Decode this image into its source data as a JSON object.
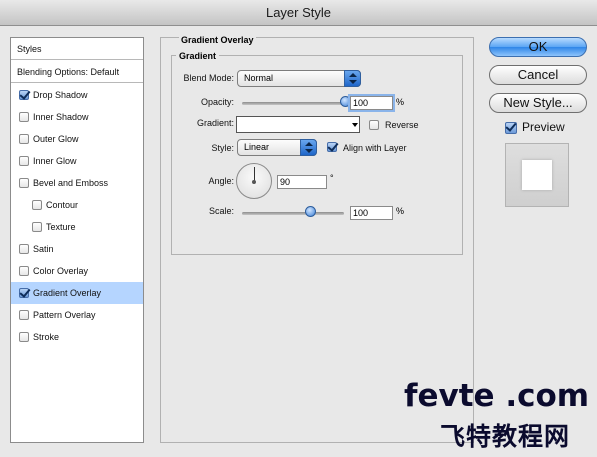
{
  "window": {
    "title": "Layer Style"
  },
  "style_list": {
    "header": "Styles",
    "blending": "Blending Options: Default",
    "items": [
      {
        "label": "Drop Shadow",
        "checked": true,
        "selected": false,
        "indent": false
      },
      {
        "label": "Inner Shadow",
        "checked": false,
        "selected": false,
        "indent": false
      },
      {
        "label": "Outer Glow",
        "checked": false,
        "selected": false,
        "indent": false
      },
      {
        "label": "Inner Glow",
        "checked": false,
        "selected": false,
        "indent": false
      },
      {
        "label": "Bevel and Emboss",
        "checked": false,
        "selected": false,
        "indent": false
      },
      {
        "label": "Contour",
        "checked": false,
        "selected": false,
        "indent": true
      },
      {
        "label": "Texture",
        "checked": false,
        "selected": false,
        "indent": true
      },
      {
        "label": "Satin",
        "checked": false,
        "selected": false,
        "indent": false
      },
      {
        "label": "Color Overlay",
        "checked": false,
        "selected": false,
        "indent": false
      },
      {
        "label": "Gradient Overlay",
        "checked": true,
        "selected": true,
        "indent": false
      },
      {
        "label": "Pattern Overlay",
        "checked": false,
        "selected": false,
        "indent": false
      },
      {
        "label": "Stroke",
        "checked": false,
        "selected": false,
        "indent": false
      }
    ]
  },
  "panel": {
    "title": "Gradient Overlay",
    "subtitle": "Gradient",
    "blend_mode_label": "Blend Mode:",
    "blend_mode_value": "Normal",
    "opacity_label": "Opacity:",
    "opacity_value": "100",
    "opacity_unit": "%",
    "opacity_fraction": 1.0,
    "gradient_label": "Gradient:",
    "reverse_label": "Reverse",
    "reverse_checked": false,
    "style_label": "Style:",
    "style_value": "Linear",
    "align_label": "Align with Layer",
    "align_checked": true,
    "angle_label": "Angle:",
    "angle_value": "90",
    "angle_unit": "°",
    "scale_label": "Scale:",
    "scale_value": "100",
    "scale_unit": "%",
    "scale_fraction": 0.66
  },
  "buttons": {
    "ok": "OK",
    "cancel": "Cancel",
    "new_style": "New Style...",
    "preview_label": "Preview",
    "preview_checked": true
  },
  "watermark": {
    "line1": "fevte .com",
    "line2": "飞特教程网"
  },
  "colors": {
    "selection": "#b5d5ff",
    "accent": "#2f86e8"
  }
}
